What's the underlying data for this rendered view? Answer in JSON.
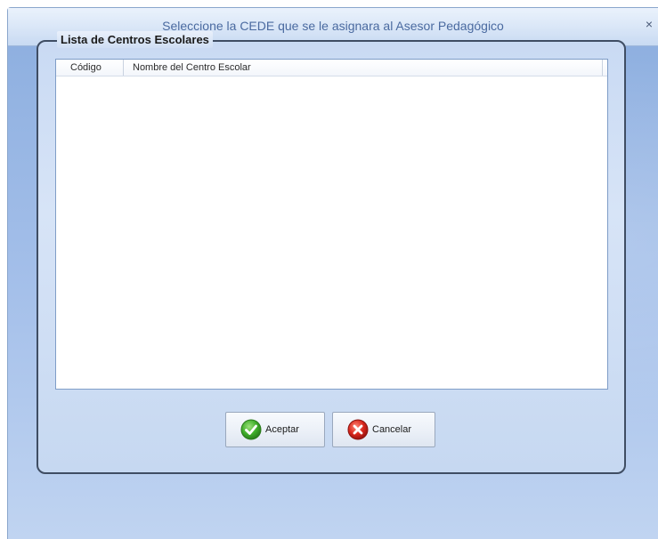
{
  "window": {
    "title": "Seleccione la CEDE que se le asignara al Asesor Pedagógico",
    "close_glyph": "×"
  },
  "group": {
    "legend": "Lista de Centros Escolares"
  },
  "list": {
    "columns": [
      "Código",
      "Nombre del Centro Escolar"
    ],
    "rows": []
  },
  "buttons": {
    "ok_label": "Aceptar",
    "ok_icon": "green-check-icon",
    "cancel_label": "Cancelar",
    "cancel_icon": "red-x-icon"
  },
  "colors": {
    "title_text": "#4a6aa0",
    "ok_icon": "#3fae2a",
    "cancel_icon": "#d9261c"
  }
}
